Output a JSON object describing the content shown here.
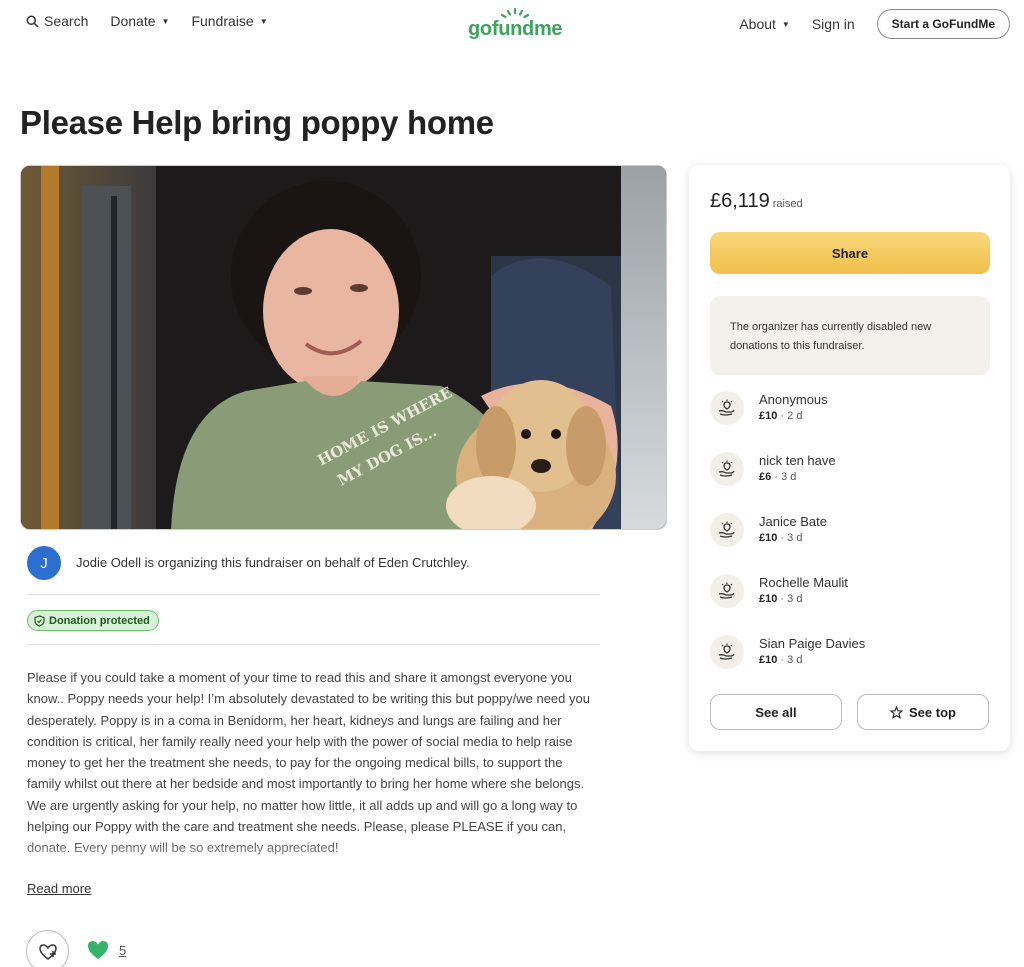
{
  "header": {
    "search_label": "Search",
    "donate_label": "Donate",
    "fundraise_label": "Fundraise",
    "logo_text": "gofundme",
    "about_label": "About",
    "signin_label": "Sign in",
    "start_label": "Start a GoFundMe"
  },
  "page": {
    "title": "Please Help bring poppy home",
    "tshirt_text": "HOME IS WHERE MY DOG IS"
  },
  "organizer": {
    "avatar_initial": "J",
    "text": "Jodie Odell is organizing this fundraiser on behalf of Eden Crutchley."
  },
  "badge": {
    "label": "Donation protected"
  },
  "story": {
    "text": "Please if you could take a moment of your time to read this and share it amongst everyone you know.. Poppy needs your help! I’m absolutely devastated to be writing this but poppy/we need you desperately. Poppy is in a coma in Benidorm, her heart, kidneys and lungs are failing and her condition is critical, her family really need your help with the power of social media to help raise money to get her the treatment she needs, to pay for the ongoing medical bills, to support the family whilst out there at her bedside and most importantly to bring her home where she belongs. We are urgently asking for your help, no matter how little, it all adds up and will go a long way to helping our Poppy with the care and treatment she needs. Please, please PLEASE if you can, donate. Every penny will be so extremely appreciated!",
    "read_more": "Read more"
  },
  "hearts": {
    "count": "5"
  },
  "sidebar": {
    "amount": "£6,119",
    "amount_label": "raised",
    "share_label": "Share",
    "notice": "The organizer has currently disabled new donations to this fundraiser.",
    "donors": [
      {
        "name": "Anonymous",
        "amount": "£10",
        "time": "2 d"
      },
      {
        "name": "nick ten have",
        "amount": "£6",
        "time": "3 d"
      },
      {
        "name": "Janice Bate",
        "amount": "£10",
        "time": "3 d"
      },
      {
        "name": "Rochelle Maulit",
        "amount": "£10",
        "time": "3 d"
      },
      {
        "name": "Sian Paige Davies",
        "amount": "£10",
        "time": "3 d"
      }
    ],
    "see_all_label": "See all",
    "see_top_label": "See top"
  },
  "colors": {
    "brand_green": "#3ca45c",
    "share_yellow": "#f0c04a",
    "avatar_blue": "#2d6fd0"
  }
}
